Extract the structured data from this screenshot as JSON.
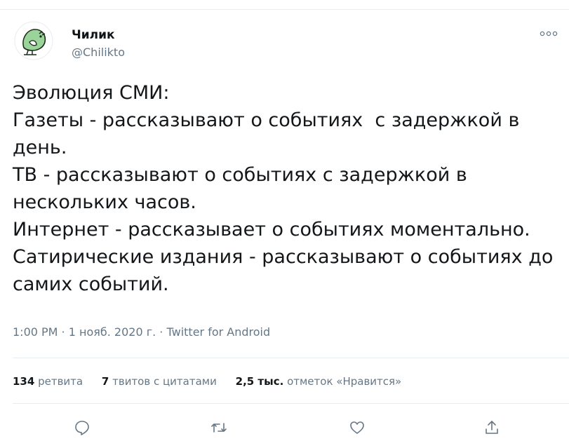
{
  "author": {
    "name": "Чилик",
    "handle": "@Chilikto"
  },
  "tweet": {
    "text": "Эволюция СМИ:\nГазеты - рассказывают о событиях  с задержкой в\nдень.\nТВ - рассказывают о событиях с задержкой в\nнескольких часов.\nИнтернет - рассказывает о событиях моментально.\nСатирические издания - рассказывают о событиях до\nсамих событий.",
    "time": "1:00 PM",
    "date": "1 нояб. 2020 г.",
    "source": "Twitter for Android",
    "meta_sep": " · "
  },
  "stats": {
    "retweets": {
      "count": "134",
      "label": "ретвита"
    },
    "quotes": {
      "count": "7",
      "label": "твитов с цитатами"
    },
    "likes": {
      "count": "2,5 тыс.",
      "label": "отметок «Нравится»"
    }
  },
  "colors": {
    "muted": "#657786",
    "divider": "#e6ecf0",
    "avatar_green": "#9bd49a"
  },
  "icons": [
    "more-icon",
    "reply-icon",
    "retweet-icon",
    "like-icon",
    "share-icon"
  ]
}
